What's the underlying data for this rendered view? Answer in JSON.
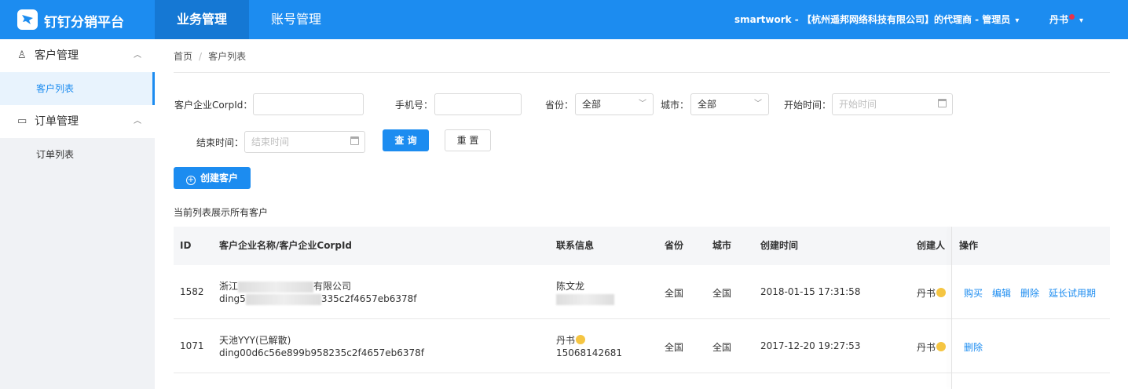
{
  "header": {
    "app_title": "钉钉分销平台",
    "tabs": [
      {
        "label": "业务管理",
        "active": true
      },
      {
        "label": "账号管理",
        "active": false
      }
    ],
    "tenant": "smartwork - 【杭州遥邦网络科技有限公司】的代理商 - 管理员",
    "user": "丹书",
    "accent_color": "#1c8cf0"
  },
  "sidebar": {
    "groups": [
      {
        "label": "客户管理",
        "icon": "user-icon",
        "items": [
          {
            "label": "客户列表",
            "active": true
          }
        ]
      },
      {
        "label": "订单管理",
        "icon": "monitor-icon",
        "items": [
          {
            "label": "订单列表",
            "active": false
          }
        ]
      }
    ]
  },
  "breadcrumb": {
    "home": "首页",
    "separator": "/",
    "current": "客户列表"
  },
  "filters": {
    "corpid_label": "客户企业CorpId：",
    "phone_label": "手机号：",
    "province_label": "省份：",
    "province_value": "全部",
    "city_label": "城市：",
    "city_value": "全部",
    "start_label": "开始时间：",
    "start_placeholder": "开始时间",
    "end_label": "结束时间：",
    "end_placeholder": "结束时间",
    "query_button": "查 询",
    "reset_button": "重 置"
  },
  "create_button": "创建客户",
  "list_caption": "当前列表展示所有客户",
  "table": {
    "columns": [
      "ID",
      "客户企业名称/客户企业CorpId",
      "联系信息",
      "省份",
      "城市",
      "创建时间",
      "创建人",
      "操作"
    ],
    "rows": [
      {
        "id": "1582",
        "name_prefix": "浙江",
        "name_suffix": "有限公司",
        "corpid_prefix": "ding5",
        "corpid_suffix": "335c2f4657eb6378f",
        "contact_name": "陈文龙",
        "contact_phone": "",
        "province": "全国",
        "city": "全国",
        "created": "2018-01-15 17:31:58",
        "creator": "丹书",
        "actions": [
          "购买",
          "编辑",
          "删除",
          "延长试用期"
        ]
      },
      {
        "id": "1071",
        "name": "天池YYY(已解散)",
        "corpid": "ding00d6c56e899b958235c2f4657eb6378f",
        "contact_name": "丹书",
        "contact_phone": "15068142681",
        "province": "全国",
        "city": "全国",
        "created": "2017-12-20 19:27:53",
        "creator": "丹书",
        "actions": [
          "删除"
        ]
      }
    ]
  }
}
